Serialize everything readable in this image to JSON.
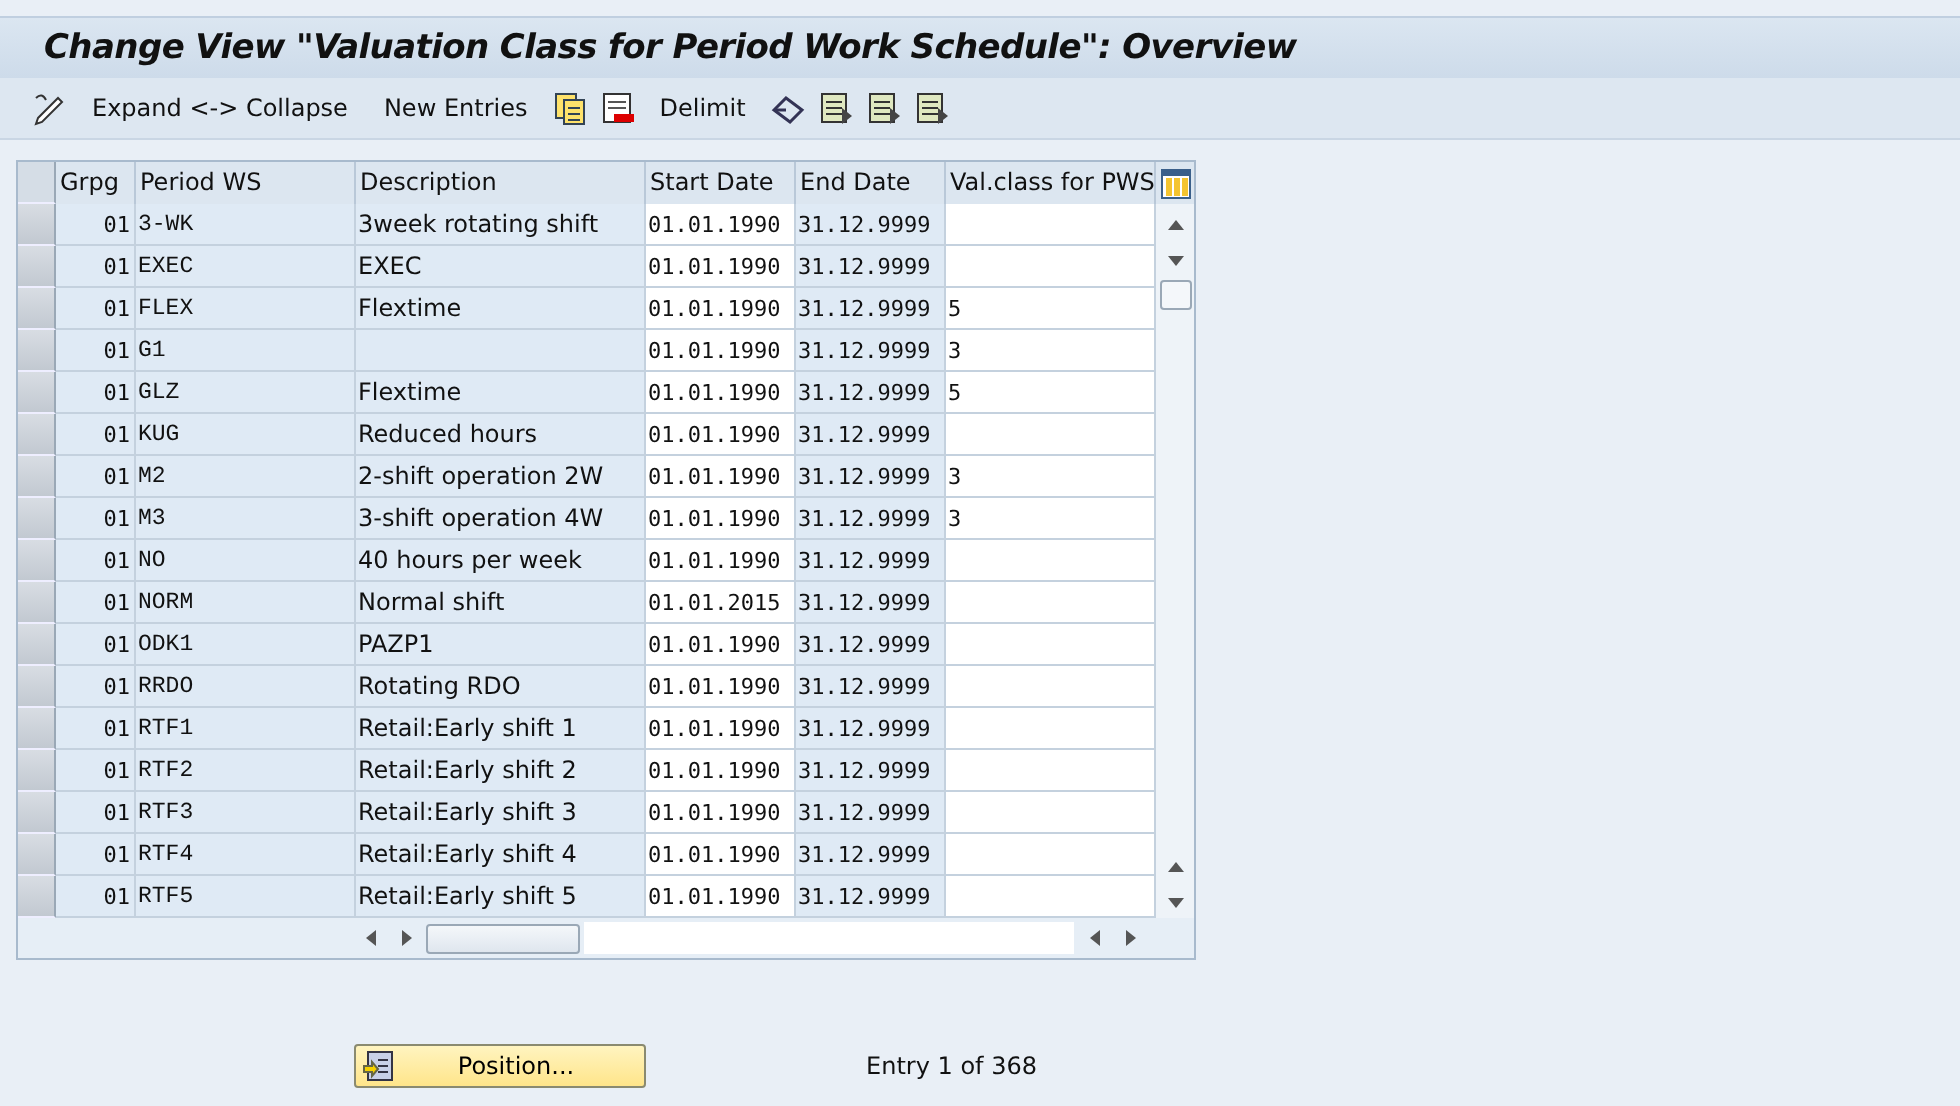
{
  "window": {
    "title": "Change View \"Valuation Class for Period Work Schedule\": Overview"
  },
  "toolbar": {
    "items": [
      {
        "kind": "pencil"
      },
      {
        "kind": "text",
        "label": "Expand <-> Collapse"
      },
      {
        "kind": "text",
        "label": "New Entries"
      },
      {
        "kind": "copy"
      },
      {
        "kind": "delete"
      },
      {
        "kind": "text",
        "label": "Delimit"
      },
      {
        "kind": "undo"
      },
      {
        "kind": "list"
      },
      {
        "kind": "list"
      },
      {
        "kind": "list"
      }
    ]
  },
  "table": {
    "columns": [
      "Grpg",
      "Period WS",
      "Description",
      "Start Date",
      "End Date",
      "Val.class for PWS"
    ],
    "rows": [
      [
        "01",
        "3-WK",
        "3week rotating shift",
        "01.01.1990",
        "31.12.9999",
        ""
      ],
      [
        "01",
        "EXEC",
        "EXEC",
        "01.01.1990",
        "31.12.9999",
        ""
      ],
      [
        "01",
        "FLEX",
        "Flextime",
        "01.01.1990",
        "31.12.9999",
        "5"
      ],
      [
        "01",
        "G1",
        "",
        "01.01.1990",
        "31.12.9999",
        "3"
      ],
      [
        "01",
        "GLZ",
        "Flextime",
        "01.01.1990",
        "31.12.9999",
        "5"
      ],
      [
        "01",
        "KUG",
        "Reduced hours",
        "01.01.1990",
        "31.12.9999",
        ""
      ],
      [
        "01",
        "M2",
        "2-shift operation 2W",
        "01.01.1990",
        "31.12.9999",
        "3"
      ],
      [
        "01",
        "M3",
        "3-shift operation 4W",
        "01.01.1990",
        "31.12.9999",
        "3"
      ],
      [
        "01",
        "NO",
        "40 hours per week",
        "01.01.1990",
        "31.12.9999",
        ""
      ],
      [
        "01",
        "NORM",
        "Normal shift",
        "01.01.2015",
        "31.12.9999",
        ""
      ],
      [
        "01",
        "ODK1",
        "PAZP1",
        "01.01.1990",
        "31.12.9999",
        ""
      ],
      [
        "01",
        "RRDO",
        "Rotating RDO",
        "01.01.1990",
        "31.12.9999",
        ""
      ],
      [
        "01",
        "RTF1",
        "Retail:Early shift 1",
        "01.01.1990",
        "31.12.9999",
        ""
      ],
      [
        "01",
        "RTF2",
        "Retail:Early shift 2",
        "01.01.1990",
        "31.12.9999",
        ""
      ],
      [
        "01",
        "RTF3",
        "Retail:Early shift 3",
        "01.01.1990",
        "31.12.9999",
        ""
      ],
      [
        "01",
        "RTF4",
        "Retail:Early shift 4",
        "01.01.1990",
        "31.12.9999",
        ""
      ],
      [
        "01",
        "RTF5",
        "Retail:Early shift 5",
        "01.01.1990",
        "31.12.9999",
        ""
      ]
    ]
  },
  "position_button": {
    "label": "Position..."
  },
  "entry_info": "Entry 1 of 368"
}
